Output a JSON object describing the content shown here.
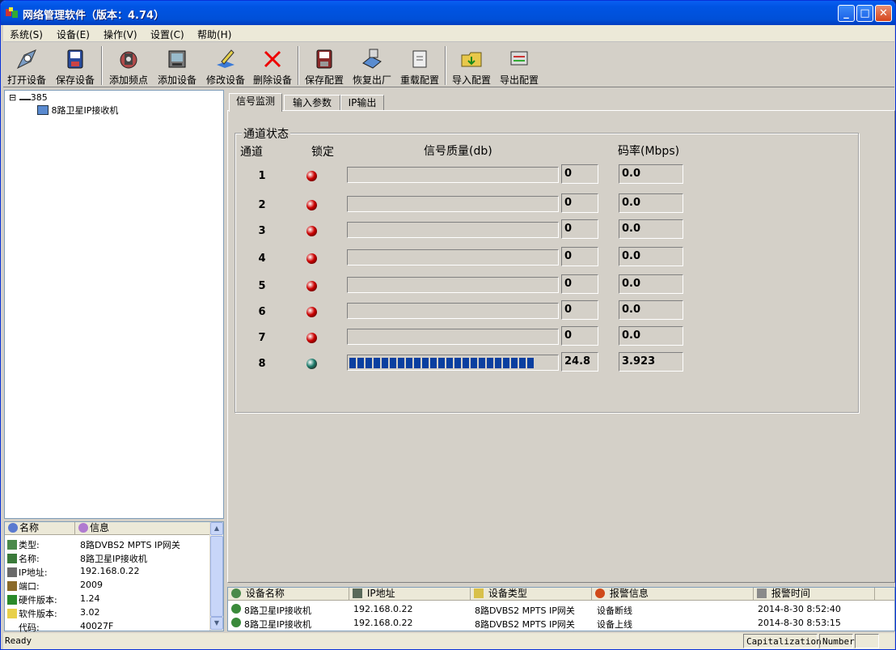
{
  "window": {
    "title": "网络管理软件（版本：4.74）",
    "min": "_",
    "max": "□",
    "close": "✕"
  },
  "menu": [
    "系统(S)",
    "设备(E)",
    "操作(V)",
    "设置(C)",
    "帮助(H)"
  ],
  "toolbar": [
    {
      "label": "打开设备",
      "icon": "open-device-icon"
    },
    {
      "label": "保存设备",
      "icon": "save-device-icon"
    },
    {
      "label": "添加频点",
      "icon": "add-frequency-icon"
    },
    {
      "label": "添加设备",
      "icon": "add-device-icon"
    },
    {
      "label": "修改设备",
      "icon": "edit-device-icon"
    },
    {
      "label": "删除设备",
      "icon": "delete-device-icon"
    },
    {
      "label": "保存配置",
      "icon": "save-config-icon"
    },
    {
      "label": "恢复出厂",
      "icon": "factory-reset-icon"
    },
    {
      "label": "重载配置",
      "icon": "reload-config-icon"
    },
    {
      "label": "导入配置",
      "icon": "import-config-icon"
    },
    {
      "label": "导出配置",
      "icon": "export-config-icon"
    }
  ],
  "tree": {
    "root": "385",
    "child": "8路卫星IP接收机",
    "expander": "⊟"
  },
  "info": {
    "headers": [
      "名称",
      "信息"
    ],
    "rows": [
      {
        "key": "类型:",
        "value": "8路DVBS2 MPTS IP网关"
      },
      {
        "key": "名称:",
        "value": "8路卫星IP接收机"
      },
      {
        "key": "IP地址:",
        "value": "192.168.0.22"
      },
      {
        "key": "端口:",
        "value": "2009"
      },
      {
        "key": "硬件版本:",
        "value": "1.24"
      },
      {
        "key": "软件版本:",
        "value": "3.02"
      },
      {
        "key": "代码:",
        "value": "40027F"
      }
    ]
  },
  "tabs": [
    "信号监测",
    "输入参数",
    "IP输出"
  ],
  "channel_status": {
    "group_title": "通道状态",
    "headers": {
      "channel": "通道",
      "lock": "锁定",
      "quality": "信号质量(db)",
      "bitrate": "码率(Mbps)"
    },
    "channels": [
      {
        "ch": "1",
        "locked": false,
        "quality": "0",
        "bitrate": "0.0",
        "fill": 0
      },
      {
        "ch": "2",
        "locked": false,
        "quality": "0",
        "bitrate": "0.0",
        "fill": 0
      },
      {
        "ch": "3",
        "locked": false,
        "quality": "0",
        "bitrate": "0.0",
        "fill": 0
      },
      {
        "ch": "4",
        "locked": false,
        "quality": "0",
        "bitrate": "0.0",
        "fill": 0
      },
      {
        "ch": "5",
        "locked": false,
        "quality": "0",
        "bitrate": "0.0",
        "fill": 0
      },
      {
        "ch": "6",
        "locked": false,
        "quality": "0",
        "bitrate": "0.0",
        "fill": 0
      },
      {
        "ch": "7",
        "locked": false,
        "quality": "0",
        "bitrate": "0.0",
        "fill": 0
      },
      {
        "ch": "8",
        "locked": true,
        "quality": "24.8",
        "bitrate": "3.923",
        "fill": 0.88
      }
    ],
    "colors": {
      "led_off": "#cc0000",
      "led_on": "#1a7a6a",
      "bar": "#0a3fa0"
    }
  },
  "alarms": {
    "headers": [
      "设备名称",
      "IP地址",
      "设备类型",
      "报警信息",
      "报警时间"
    ],
    "rows": [
      [
        "8路卫星IP接收机",
        "192.168.0.22",
        "8路DVBS2 MPTS IP网关",
        "设备断线",
        "2014-8-30 8:52:40"
      ],
      [
        "8路卫星IP接收机",
        "192.168.0.22",
        "8路DVBS2 MPTS IP网关",
        "设备上线",
        "2014-8-30 8:53:15"
      ]
    ]
  },
  "statusbar": {
    "text": "Ready",
    "cap": "Capitalization",
    "num": "Number"
  }
}
